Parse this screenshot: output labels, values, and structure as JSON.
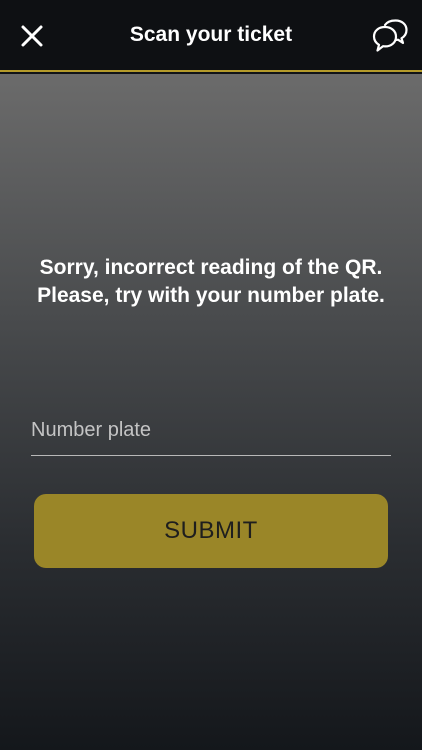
{
  "header": {
    "title": "Scan your ticket",
    "close_icon": "close-icon",
    "chat_icon": "chat-bubbles-icon"
  },
  "main": {
    "message": "Sorry, incorrect reading of the QR. Please, try with your number plate.",
    "plate_input": {
      "value": "",
      "placeholder": "Number plate"
    },
    "submit_label": "SUBMIT"
  },
  "colors": {
    "header_bg": "#0e1013",
    "accent": "#b49a2a",
    "button_bg": "#9a8628",
    "text": "#ffffff"
  }
}
